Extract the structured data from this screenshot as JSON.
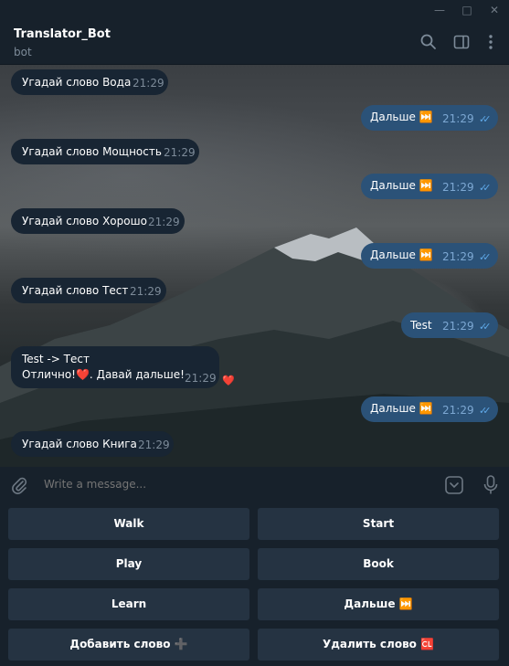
{
  "window": {
    "minimize_glyph": "—",
    "maximize_glyph": "□",
    "close_glyph": "✕"
  },
  "header": {
    "title": "Translator_Bot",
    "subtitle": "bot"
  },
  "messages": [
    {
      "dir": "in",
      "text": "Угадай слово Вода",
      "time": "21:29"
    },
    {
      "dir": "out",
      "text": "Дальше ⏭️",
      "time": "21:29"
    },
    {
      "dir": "in",
      "text": "Угадай слово Мощность",
      "time": "21:29"
    },
    {
      "dir": "out",
      "text": "Дальше ⏭️",
      "time": "21:29"
    },
    {
      "dir": "in",
      "text": "Угадай слово Хорошо",
      "time": "21:29"
    },
    {
      "dir": "out",
      "text": "Дальше ⏭️",
      "time": "21:29"
    },
    {
      "dir": "in",
      "text": "Угадай слово Тест",
      "time": "21:29"
    },
    {
      "dir": "out",
      "text": "Test",
      "time": "21:29"
    },
    {
      "dir": "in",
      "line1": "Test -> Тест",
      "line2": "Отлично!❤️. Давай дальше!",
      "time": "21:29",
      "reaction": "❤️"
    },
    {
      "dir": "out",
      "text": "Дальше ⏭️",
      "time": "21:29"
    },
    {
      "dir": "in",
      "text": "Угадай слово Книга",
      "time": "21:29"
    }
  ],
  "input": {
    "placeholder": "Write a message..."
  },
  "keyboard": {
    "buttons": [
      "Walk",
      "Start",
      "Play",
      "Book",
      "Learn",
      "Дальше ⏭️",
      "Добавить слово ➕",
      "Удалить слово 🆑"
    ]
  },
  "colors": {
    "incoming": "#182533",
    "outgoing": "#2b5278",
    "panel": "#17212b",
    "key": "#253342"
  }
}
